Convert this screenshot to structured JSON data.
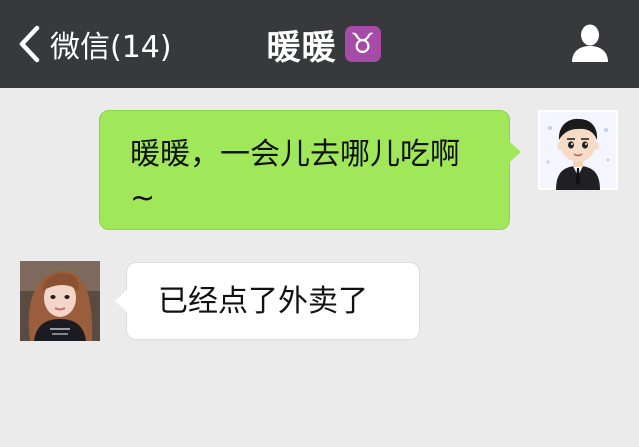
{
  "navbar": {
    "back_label": "微信(14)",
    "title": "暖暖",
    "title_badge": "♉",
    "back_icon": "chevron-left-icon",
    "profile_icon": "person-icon",
    "background": "#38393d"
  },
  "messages": [
    {
      "sender": "me",
      "text": "暖暖，一会儿去哪儿吃啊~",
      "bubble_color": "#a0e75a"
    },
    {
      "sender": "other",
      "text": "已经点了外卖了",
      "bubble_color": "#ffffff"
    }
  ],
  "colors": {
    "chat_background": "#ebebeb",
    "zodiac_badge": "#a64ca6"
  }
}
